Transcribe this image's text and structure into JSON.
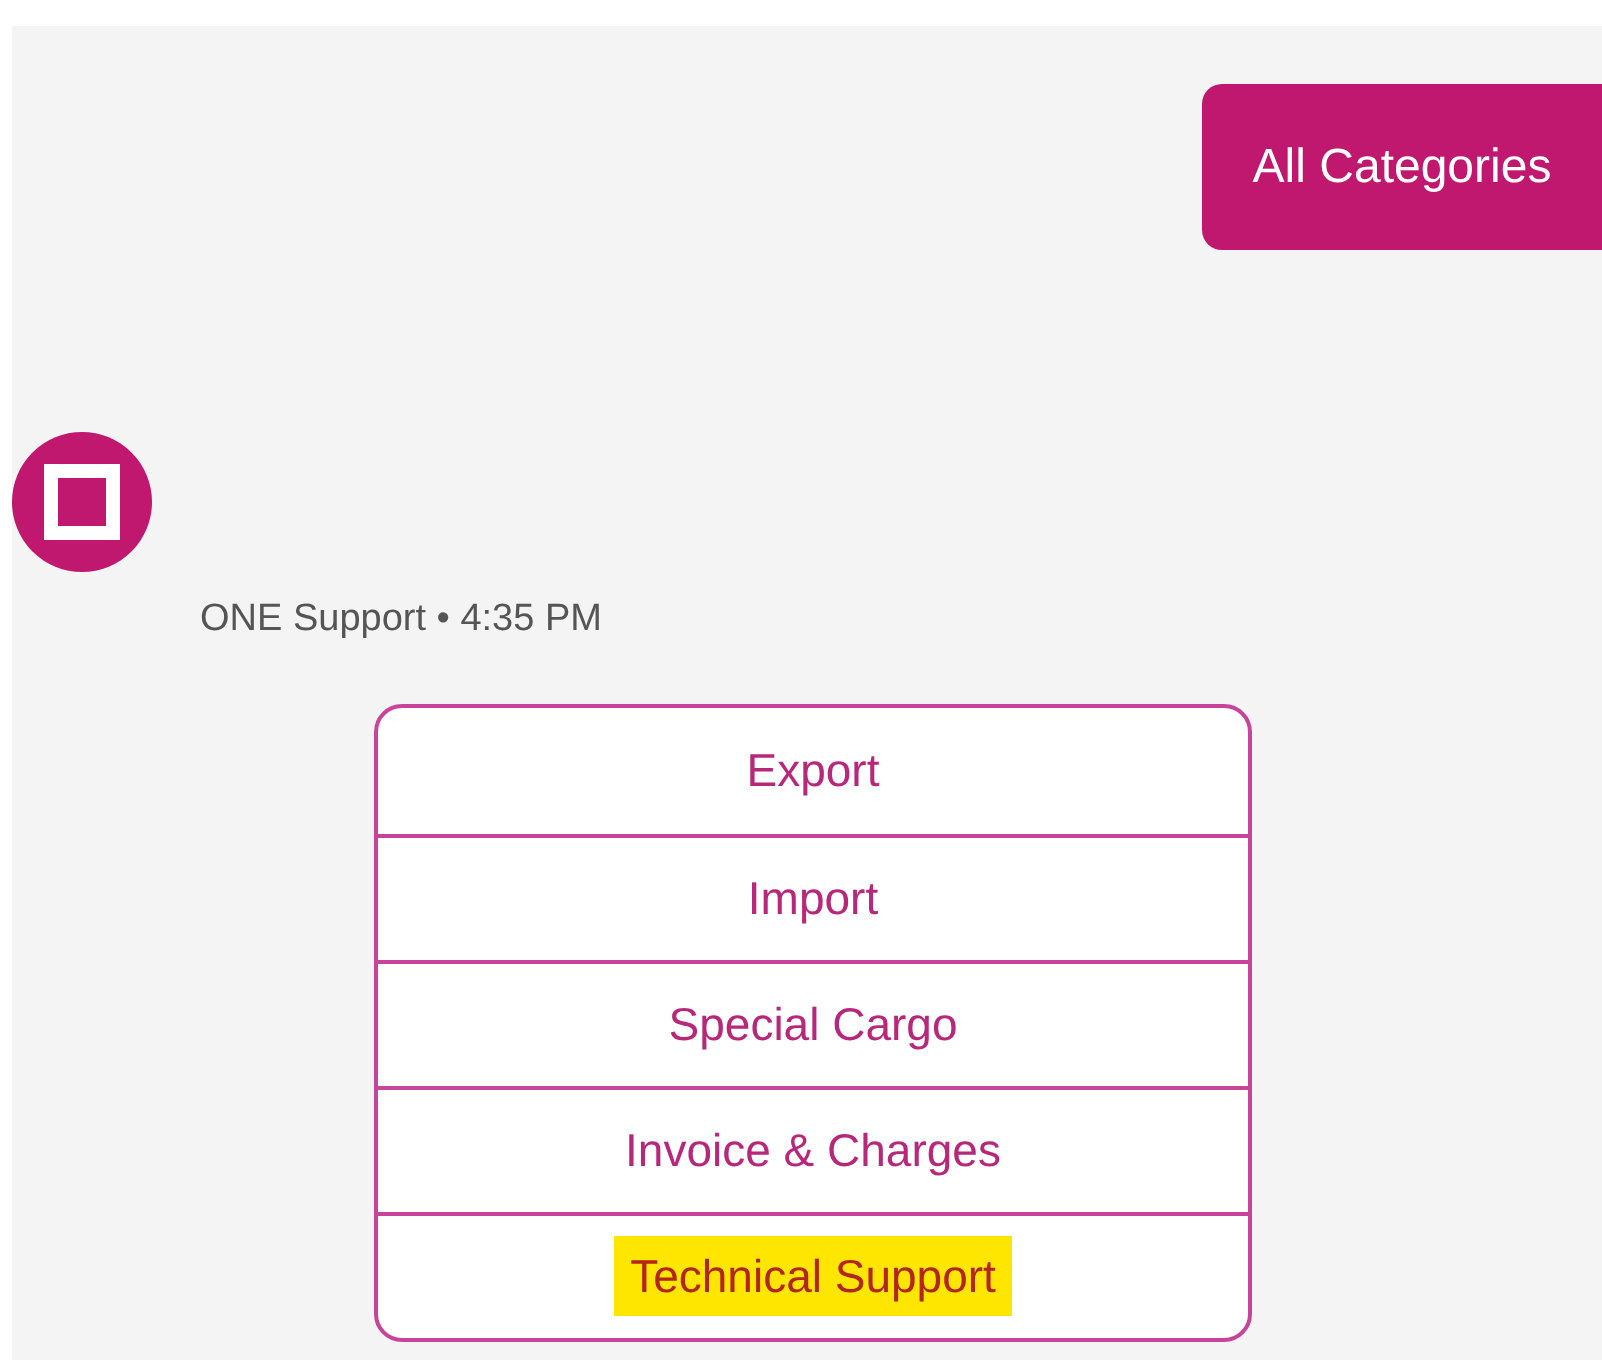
{
  "user_message": {
    "text": "All Categories"
  },
  "bot_message": {
    "caption": "ONE Support • 4:35 PM"
  },
  "options": [
    {
      "label": "Export",
      "highlighted": false
    },
    {
      "label": "Import",
      "highlighted": false
    },
    {
      "label": "Special Cargo",
      "highlighted": false
    },
    {
      "label": "Invoice & Charges",
      "highlighted": false
    },
    {
      "label": "Technical Support",
      "highlighted": true
    }
  ]
}
